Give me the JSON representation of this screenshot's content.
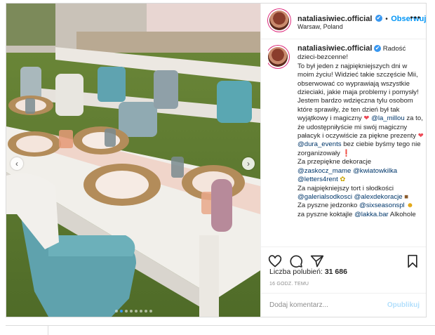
{
  "header": {
    "username": "nataliasiwiec.official",
    "verified_mark": "✔",
    "separator": "•",
    "follow_label": "Obserwuj",
    "location": "Warsaw, Poland",
    "more_label": "•••"
  },
  "caption": {
    "username": "nataliasiwiec.official",
    "p1": "Radość dzieci-bezcenne!",
    "p2": "To był jeden z najpiękniejszych dni w moim życiu! Widzieć takie szczęście Mii, obserwować co wyprawiają wszystkie dzieciaki, jakie maja problemy i pomysły!",
    "p3a": "Jestem bardzo wdzięczna tylu osobom które sprawiły, że ten dzień był tak wyjątkowy i magiczny",
    "mention1": "@la_millou",
    "p3b": "za to, że udostępniłyście mi swój magiczny pałacyk i oczywiście za piękne prezenty",
    "mention2": "@dura_events",
    "p3c": "bez ciebie byśmy tego nie zorganizowały",
    "p4": "Za przepiękne dekoracje",
    "mention3": "@zaskocz_mame",
    "mention4": "@kwiatowkilka",
    "mention5": "@letters4rent",
    "p5": "Za najpiękniejszy tort i słodkości",
    "mention6": "@galerialsodkosci",
    "mention7": "@alexdekoracje",
    "p6": "Za pyszne jedzonko",
    "mention8": "@sixseasonspl",
    "p7": "za pyszne koktajle",
    "mention9": "@lakka.bar",
    "p7b": "Alkohole"
  },
  "actions": {
    "likes_label": "Liczba polubień:",
    "likes_count": "31 686",
    "timestamp": "16 GODZ. TEMU"
  },
  "comment": {
    "placeholder": "Dodaj komentarz...",
    "post_label": "Opublikuj"
  },
  "carousel": {
    "prev_arrow": "‹",
    "next_arrow": "›",
    "slide_count": 8,
    "active_slide": 1
  },
  "colors": {
    "accent": "#0095f6",
    "verified": "#3897f0",
    "heart": "#ed4956"
  }
}
